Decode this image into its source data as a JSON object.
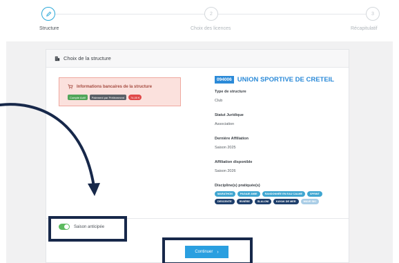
{
  "stepper": {
    "steps": [
      {
        "number": "",
        "label": "Structure",
        "icon": "pencil-icon"
      },
      {
        "number": "2",
        "label": "Choix des licences"
      },
      {
        "number": "3",
        "label": "Récapitulatif"
      }
    ],
    "colors": {
      "active": "#29a7d8",
      "inactive": "#c2c7cc"
    }
  },
  "card": {
    "title": "Choix de la structure",
    "title_icon": "building-icon"
  },
  "bank": {
    "title": "Informations bancaires de la structure",
    "icon": "cart-icon",
    "badges": [
      {
        "text": "Compte Actif",
        "color": "#51a65a"
      },
      {
        "text": "Paiement par Prélèvement",
        "color": "#5a6067"
      },
      {
        "text": "74,00 €",
        "color": "#e04848"
      }
    ]
  },
  "club": {
    "code": "094006",
    "name": "UNION SPORTIVE DE CRETEIL",
    "type_label": "Type de structure",
    "type_value": "Club",
    "status_label": "Statut Juridique",
    "status_value": "Association",
    "last_affiliation_label": "Dernière Affiliation",
    "last_affiliation_value": "Saison 2025",
    "available_affiliation_label": "Affiliation disponible",
    "available_affiliation_value": "Saison 2026",
    "disciplines_label": "Discipline(s) pratiquée(s)",
    "disciplines_row1": [
      "MARATHON",
      "PAGAIE AMIE",
      "RANDONNÉE EN EAU CALME",
      "SPRINT"
    ],
    "disciplines_row2": [
      "DESCENTE",
      "RIVIÈRE",
      "SLALOM",
      "KAYAK DE MER",
      "WAVE SKI"
    ]
  },
  "toggle": {
    "label": "Saison anticipée",
    "on": true
  },
  "continue_button": {
    "label": "Continuer",
    "icon": "chevron-right-icon",
    "color": "#2a9fe0"
  },
  "annotation": {
    "color": "#17284a"
  }
}
